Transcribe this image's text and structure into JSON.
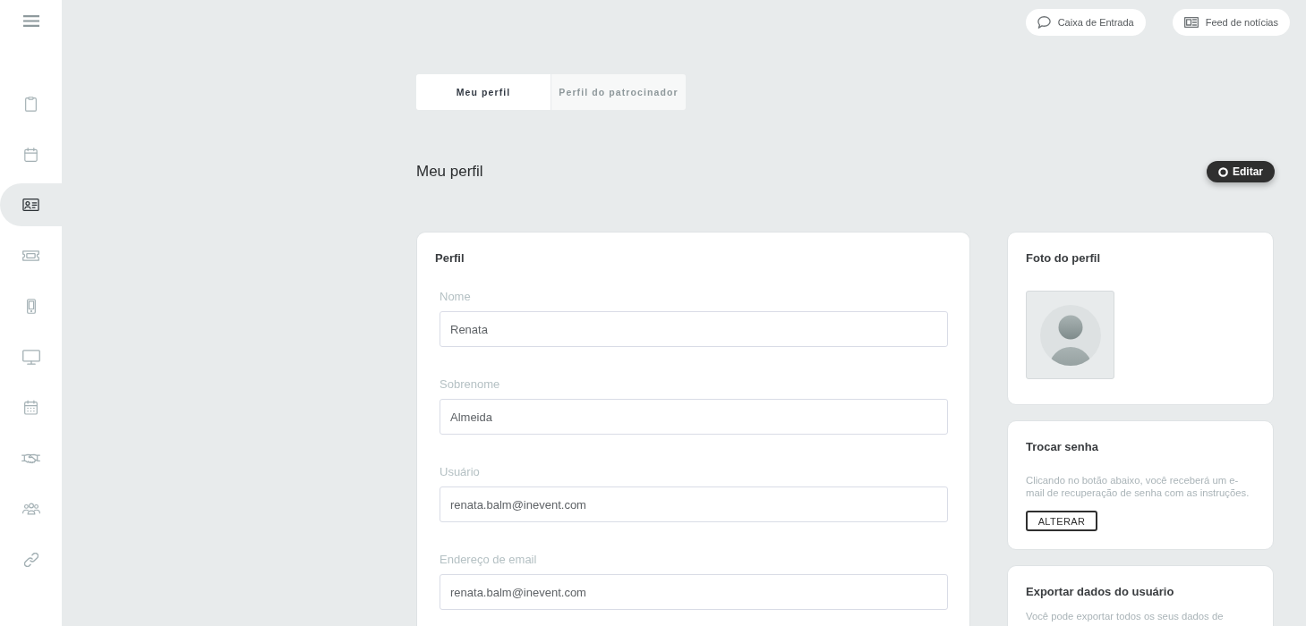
{
  "sidebar": {
    "items": [
      {
        "kind": "clipboard",
        "selected": false
      },
      {
        "kind": "calendar",
        "selected": false
      },
      {
        "kind": "idcard",
        "selected": true
      },
      {
        "kind": "ticket",
        "selected": false
      },
      {
        "kind": "phone",
        "selected": false
      },
      {
        "kind": "monitor",
        "selected": false
      },
      {
        "kind": "agenda",
        "selected": false
      },
      {
        "kind": "handshake",
        "selected": false
      },
      {
        "kind": "people",
        "selected": false
      },
      {
        "kind": "link",
        "selected": false
      }
    ]
  },
  "top_bar": {
    "buttons": [
      {
        "kind": "chat",
        "label": "Caixa de Entrada"
      },
      {
        "kind": "news",
        "label": "Feed de notícias"
      }
    ]
  },
  "tabs": [
    {
      "label": "Meu perfil",
      "selected": true
    },
    {
      "label": "Perfil do patrocinador",
      "selected": false
    }
  ],
  "page_header": {
    "title": "Meu perfil",
    "edit_button": "Editar"
  },
  "profile_card": {
    "title": "Perfil",
    "fields": [
      {
        "label": "Nome",
        "value": "Renata"
      },
      {
        "label": "Sobrenome",
        "value": "Almeida"
      },
      {
        "label": "Usuário",
        "value": "renata.balm@inevent.com"
      },
      {
        "label": "Endereço de email",
        "value": "renata.balm@inevent.com"
      }
    ]
  },
  "photo_card": {
    "title": "Foto do perfil"
  },
  "password_card": {
    "title": "Trocar senha",
    "text": "Clicando no botão abaixo, você receberá um e-mail de recuperação de senha com as instruções.",
    "button": "ALTERAR"
  },
  "export_card": {
    "title": "Exportar dados do usuário",
    "text": "Você pode exportar todos os seus dados de"
  }
}
